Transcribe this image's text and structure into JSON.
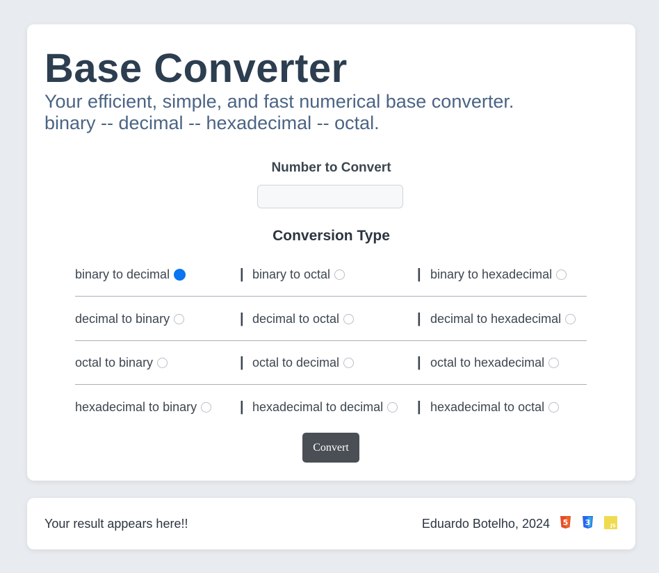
{
  "header": {
    "title": "Base Converter",
    "subtitle_line1": "Your efficient, simple, and fast numerical base converter.",
    "subtitle_line2": "binary -- decimal -- hexadecimal -- octal."
  },
  "form": {
    "number_label": "Number to Convert",
    "number_value": "",
    "conversion_title": "Conversion Type",
    "separator": "|",
    "options": [
      {
        "label": "binary to decimal",
        "checked": true
      },
      {
        "label": "binary to octal",
        "checked": false
      },
      {
        "label": "binary to hexadecimal",
        "checked": false
      },
      {
        "label": "decimal to binary",
        "checked": false
      },
      {
        "label": "decimal to octal",
        "checked": false
      },
      {
        "label": "decimal to hexadecimal",
        "checked": false
      },
      {
        "label": "octal to binary",
        "checked": false
      },
      {
        "label": "octal to decimal",
        "checked": false
      },
      {
        "label": "octal to hexadecimal",
        "checked": false
      },
      {
        "label": "hexadecimal to binary",
        "checked": false
      },
      {
        "label": "hexadecimal to decimal",
        "checked": false
      },
      {
        "label": "hexadecimal to octal",
        "checked": false
      }
    ],
    "convert_label": "Convert"
  },
  "result": {
    "text": "Your result appears here!!",
    "credit": "Eduardo Botelho, 2024",
    "tech_icons": [
      {
        "name": "html5-icon",
        "glyph": "5",
        "color": "#e44d26"
      },
      {
        "name": "css3-icon",
        "glyph": "3",
        "color": "#2965f1"
      },
      {
        "name": "javascript-icon",
        "glyph": "JS",
        "color": "#f0db4f"
      }
    ]
  },
  "colors": {
    "accent": "#0b74f0",
    "title": "#2c3e50",
    "subtitle": "#4a6484",
    "button": "#4a4f55",
    "background": "#e8ebef"
  }
}
